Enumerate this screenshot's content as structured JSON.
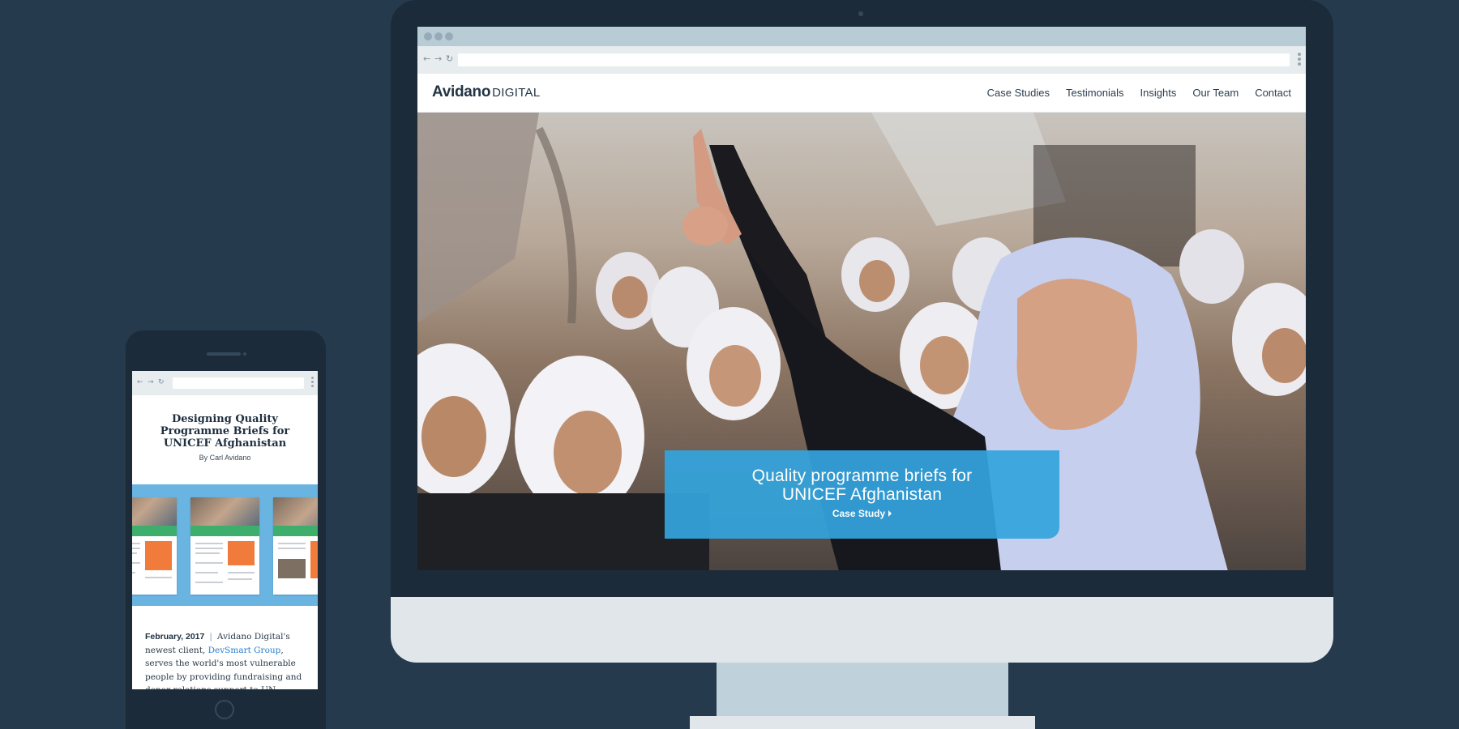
{
  "desktop": {
    "site": {
      "logo_main": "Avidano",
      "logo_sub": "DIGITAL",
      "nav": [
        "Case Studies",
        "Testimonials",
        "Insights",
        "Our Team",
        "Contact"
      ]
    },
    "hero": {
      "title_line1": "Quality programme briefs for",
      "title_line2": "UNICEF Afghanistan",
      "link_label": "Case Study",
      "caption_color": "#34a4dd"
    }
  },
  "phone": {
    "article": {
      "title": "Designing Quality Programme Briefs for UNICEF Afghanistan",
      "byline": "By Carl Avidano",
      "date": "February, 2017",
      "separator": "|",
      "body_start": "Avidano Digital's newest client,",
      "client_link": "DevSmart Group",
      "body_rest": ", serves the world's most vulnerable people by providing fundraising and donor relations support to UN"
    },
    "banner_color": "#6ab4e1"
  },
  "colors": {
    "background": "#253a4d",
    "device_frame": "#1c2b3a",
    "link": "#2a7fd0"
  },
  "icons": {
    "back": "back-arrow-icon",
    "forward": "forward-arrow-icon",
    "reload": "reload-icon",
    "menu": "kebab-menu-icon"
  }
}
